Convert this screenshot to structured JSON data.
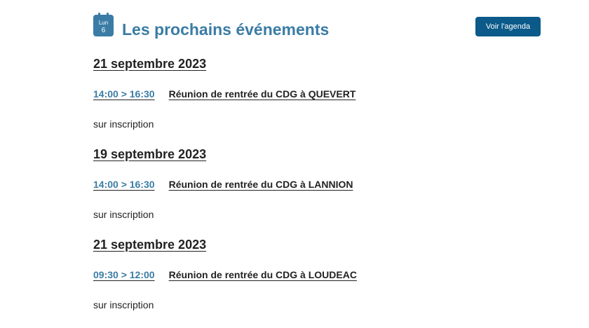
{
  "header": {
    "calendar_icon": "calendar-icon",
    "calendar_day_name": "Lun",
    "calendar_day_number": "6",
    "title": "Les prochains événements",
    "agenda_button": "Voir l'agenda"
  },
  "colors": {
    "accent": "#3a7ca5",
    "button": "#0b5a8a",
    "text": "#222222"
  },
  "events": [
    {
      "date": "21 septembre 2023",
      "time": "14:00 > 16:30",
      "title": "Réunion de rentrée du CDG à QUEVERT",
      "note": "sur inscription"
    },
    {
      "date": "19 septembre 2023",
      "time": "14:00 > 16:30",
      "title": "Réunion de rentrée du CDG à LANNION",
      "note": "sur inscription"
    },
    {
      "date": "21 septembre 2023",
      "time": "09:30 > 12:00",
      "title": "Réunion de rentrée du CDG à LOUDEAC",
      "note": "sur inscription"
    }
  ]
}
